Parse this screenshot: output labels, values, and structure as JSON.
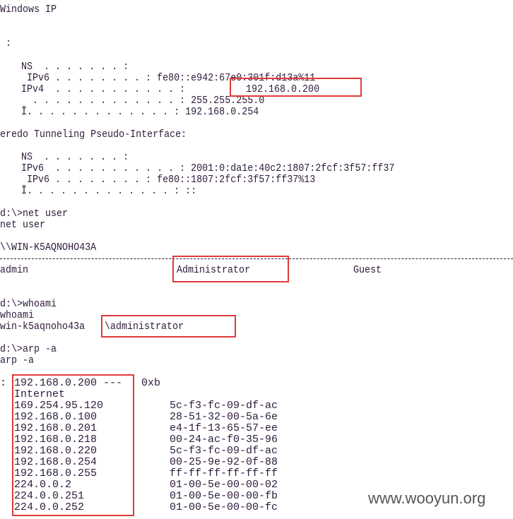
{
  "ipconfig": {
    "header": "Windows IP",
    "colon": ":",
    "adapter1": {
      "ns": "NS  . . . . . . . :",
      "ipv6": " IPv6 . . . . . . . . : fe80::e942:67e0:301f:d13a%11",
      "ipv4_label": "IPv4  . . . . . . . . . . . :",
      "ipv4_value": "192.168.0.200",
      "mask": "  . . . . . . . . . . . . . : 255.255.255.0",
      "gateway": "Ĭ. . . . . . . . . . . . . : 192.168.0.254"
    },
    "adapter2_title": "eredo Tunneling Pseudo-Interface:",
    "adapter2": {
      "ns": "NS  . . . . . . . :",
      "ipv6": "IPv6  . . . . . . . . . . . : 2001:0:da1e:40c2:1807:2fcf:3f57:ff37",
      "ipv6_local": " IPv6 . . . . . . . . : fe80::1807:2fcf:3f57:ff37%13",
      "gateway": "Ĭ. . . . . . . . . . . . . : ::"
    }
  },
  "net_user": {
    "prompt": "d:\\>net user",
    "echo": "net user",
    "host": "\\\\WIN-K5AQNOHO43A",
    "users": [
      "admin",
      "Administrator",
      "Guest"
    ]
  },
  "whoami": {
    "prompt": "d:\\>whoami",
    "echo": "whoami",
    "host_part": "win-k5aqnoho43a",
    "user_part": "\\administrator"
  },
  "arp": {
    "prompt": "d:\\>arp -a",
    "echo": "arp -a",
    "interface_prefix": ":",
    "interface_ip": "192.168.0.200 ---",
    "interface_idx": "0xb",
    "header": "Internet",
    "entries": [
      {
        "ip": "169.254.95.120",
        "mac": "5c-f3-fc-09-df-ac"
      },
      {
        "ip": "192.168.0.100",
        "mac": "28-51-32-00-5a-6e"
      },
      {
        "ip": "192.168.0.201",
        "mac": "e4-1f-13-65-57-ee"
      },
      {
        "ip": "192.168.0.218",
        "mac": "00-24-ac-f0-35-96"
      },
      {
        "ip": "192.168.0.220",
        "mac": "5c-f3-fc-09-df-ac"
      },
      {
        "ip": "192.168.0.254",
        "mac": "00-25-9e-92-0f-88"
      },
      {
        "ip": "192.168.0.255",
        "mac": "ff-ff-ff-ff-ff-ff"
      },
      {
        "ip": "224.0.0.2",
        "mac": "01-00-5e-00-00-02"
      },
      {
        "ip": "224.0.0.251",
        "mac": "01-00-5e-00-00-fb"
      },
      {
        "ip": "224.0.0.252",
        "mac": "01-00-5e-00-00-fc"
      }
    ]
  },
  "watermark": "www.wooyun.org",
  "colors": {
    "text": "#2e1a3a",
    "highlight": "#e03a3a"
  }
}
